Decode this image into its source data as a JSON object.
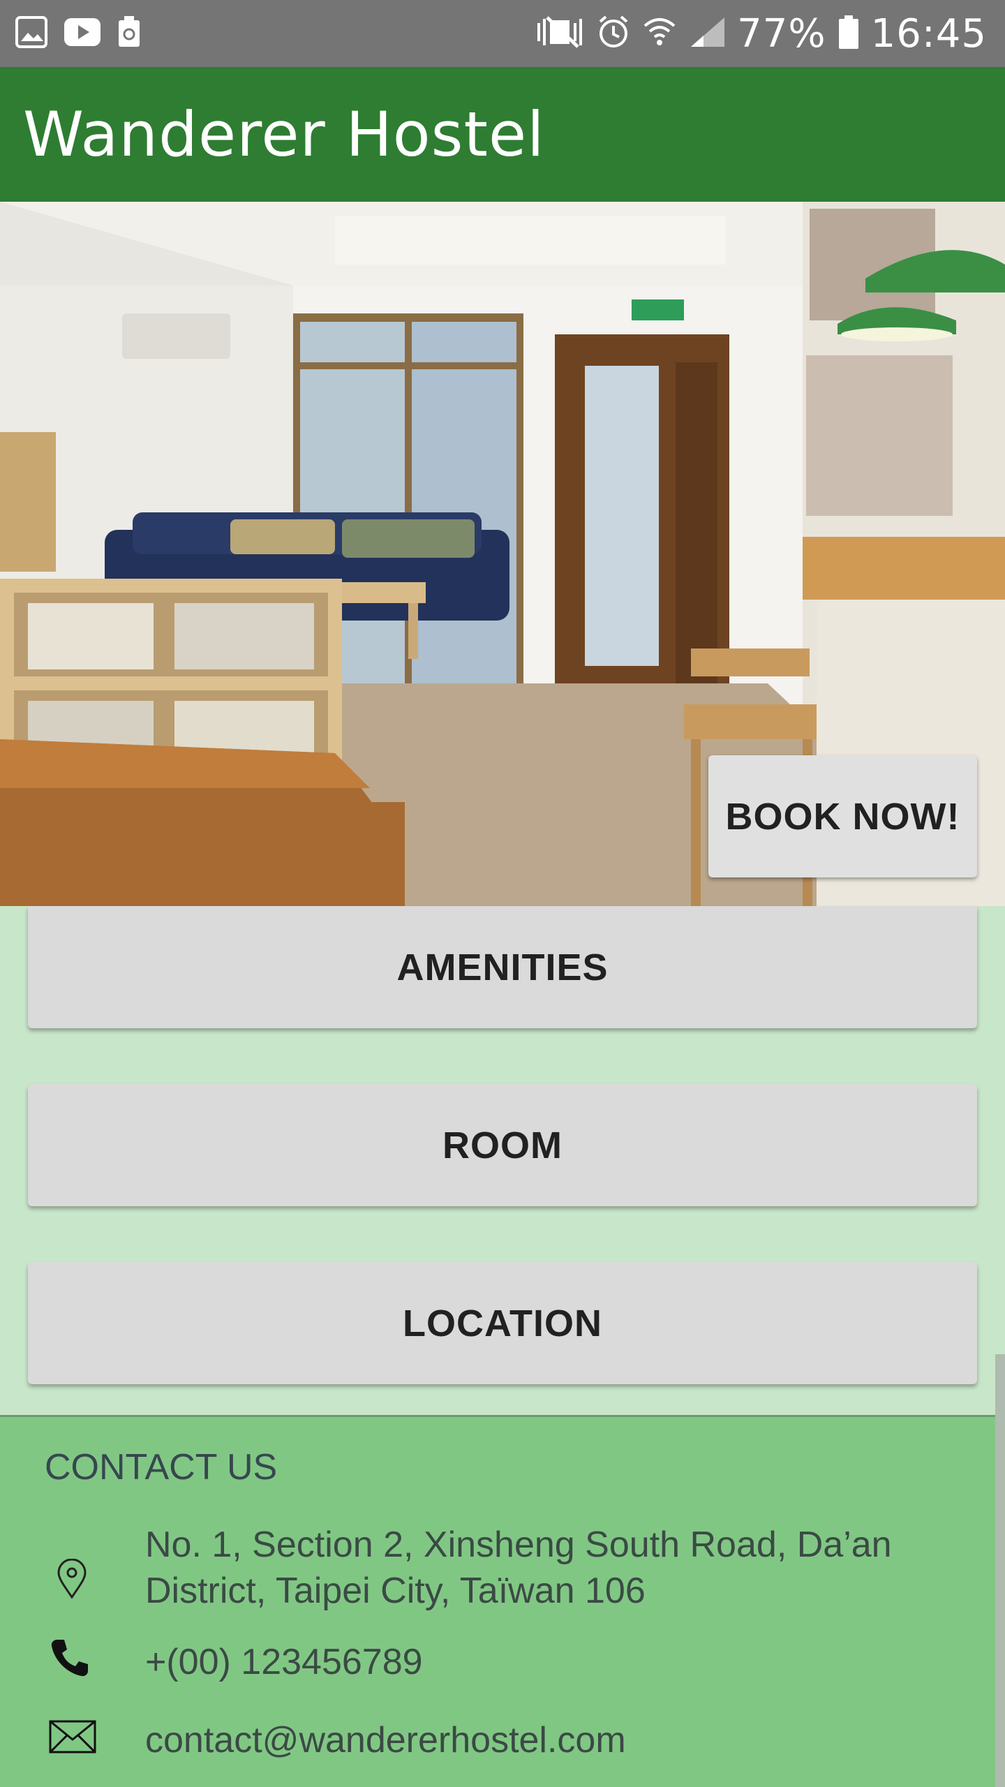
{
  "status_bar": {
    "left_icons": [
      "image-icon",
      "youtube-icon",
      "recycle-icon"
    ],
    "right_icons": [
      "mute-vibrate-icon",
      "alarm-icon",
      "wifi-icon",
      "signal-icon"
    ],
    "battery": "77%",
    "time": "16:45"
  },
  "app_bar": {
    "title": "Wanderer Hostel",
    "color": "#2e7d32"
  },
  "hero": {
    "image": "hostel-lounge-photo",
    "book_button": "BOOK NOW!"
  },
  "menu": {
    "amenities": "AMENITIES",
    "room": "ROOM",
    "location": "LOCATION"
  },
  "contact": {
    "title": "CONTACT US",
    "address_line1": "No. 1, Section 2, Xinsheng South Road, Da’an",
    "address_line2": "District, Taipei City, Taïwan 106",
    "phone": "+(00) 123456789",
    "email": "contact@wandererhostel.com",
    "icons": [
      "location-pin-icon",
      "phone-icon",
      "mail-icon"
    ]
  },
  "colors": {
    "status_bar": "#757575",
    "page_background": "#c8e6c9",
    "contact_background": "#81c784",
    "button": "#dadada"
  }
}
